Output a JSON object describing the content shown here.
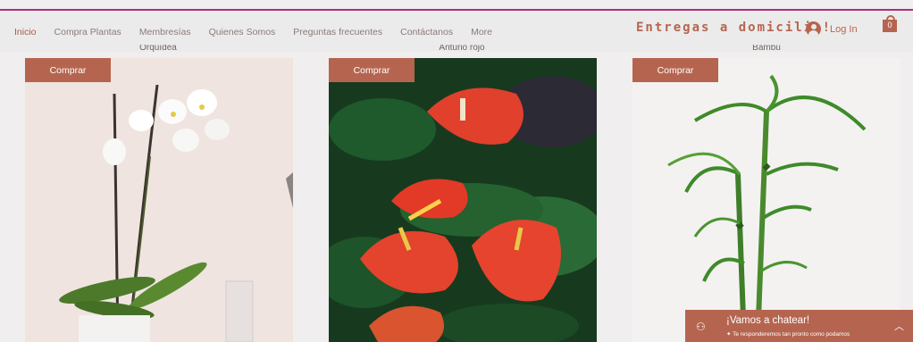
{
  "nav": {
    "items": [
      "Inicio",
      "Compra Plantas",
      "Membresías",
      "Quienes Somos",
      "Preguntas frecuentes",
      "Contáctanos",
      "More"
    ],
    "delivery": "Entregas a domicilio!",
    "login": "Log In",
    "cart_count": "0"
  },
  "products": [
    {
      "name": "Orquídea",
      "buy": "Comprar",
      "image": "white-orchid"
    },
    {
      "name": "Anturio rojo",
      "buy": "Comprar",
      "image": "red-anthurium"
    },
    {
      "name": "Bambú",
      "buy": "Comprar",
      "image": "lucky-bamboo"
    }
  ],
  "chat": {
    "title": "¡Vamos a chatear!",
    "subtitle": "Te responderemos tan pronto como podamos"
  },
  "colors": {
    "accent": "#b5654f",
    "top_line": "#a8327b",
    "page": "#f0eeee"
  }
}
